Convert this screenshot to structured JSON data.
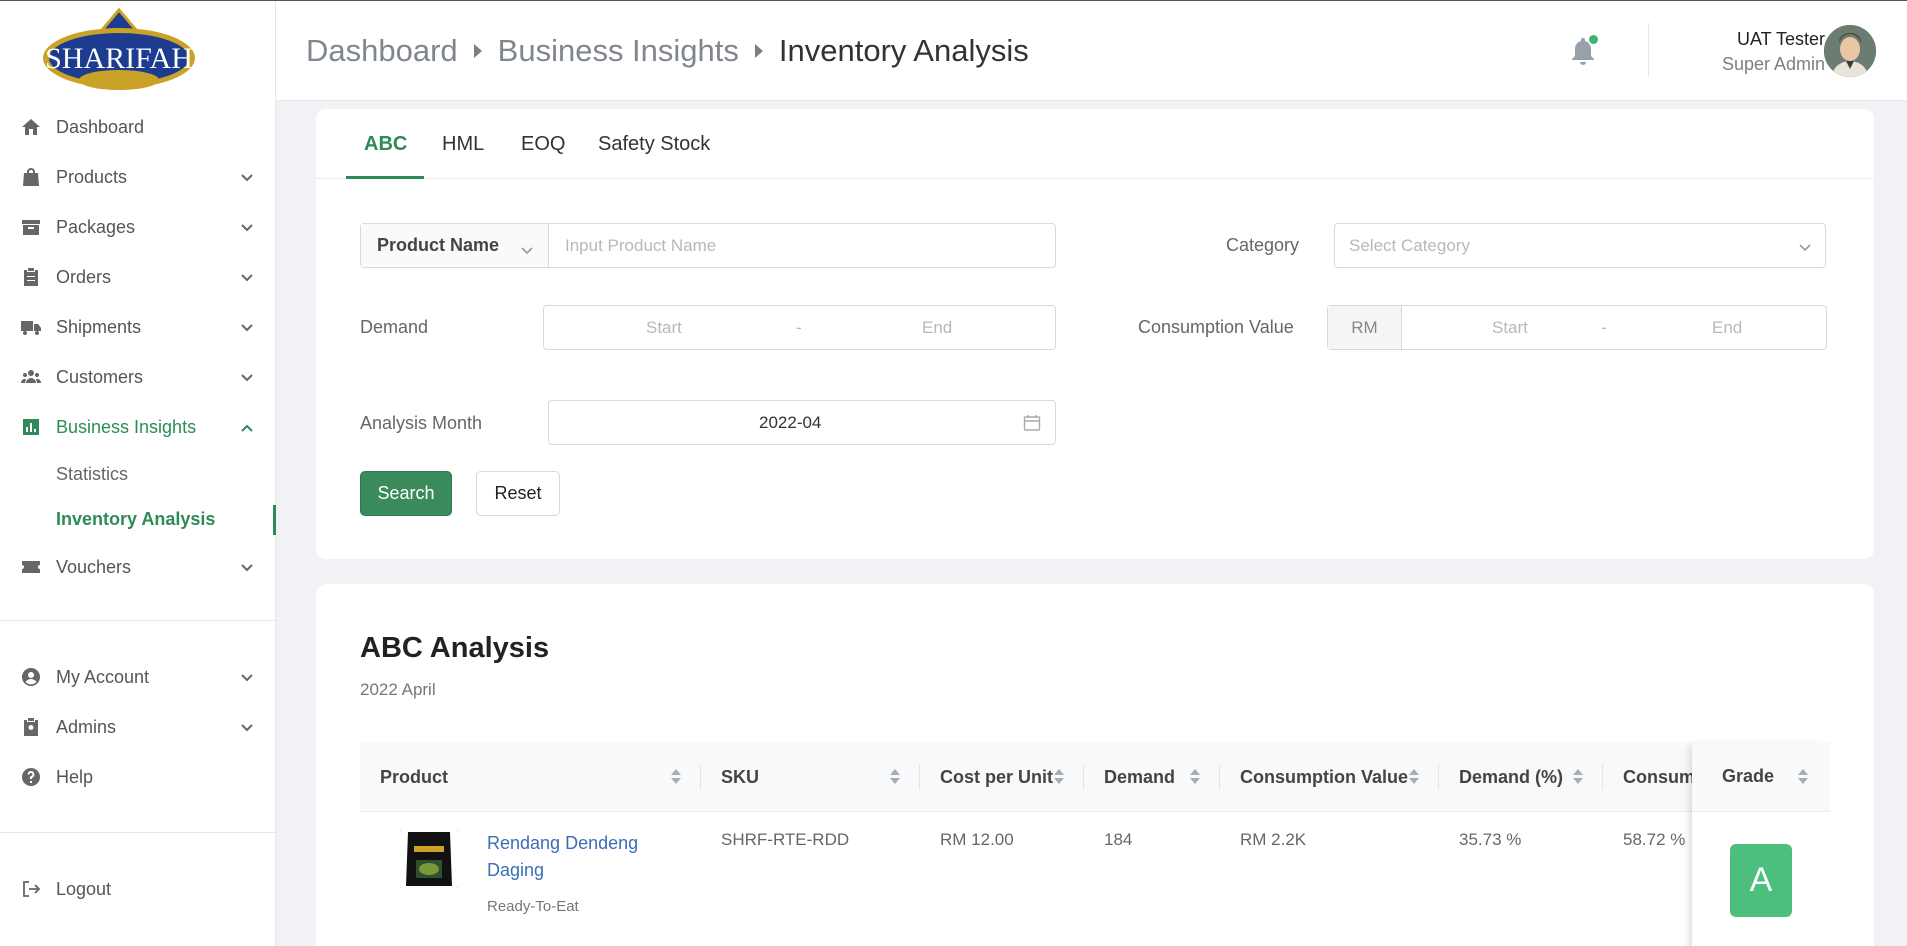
{
  "brand": {
    "logo_text": "SHARIFAH",
    "accent": "#2e8a57"
  },
  "sidebar": {
    "items": [
      {
        "label": "Dashboard",
        "icon": "home-icon"
      },
      {
        "label": "Products",
        "icon": "bag-icon"
      },
      {
        "label": "Packages",
        "icon": "archive-icon"
      },
      {
        "label": "Orders",
        "icon": "clipboard-icon"
      },
      {
        "label": "Shipments",
        "icon": "truck-icon"
      },
      {
        "label": "Customers",
        "icon": "users-icon"
      },
      {
        "label": "Business Insights",
        "icon": "chart-icon"
      }
    ],
    "sub_items": [
      {
        "label": "Statistics"
      },
      {
        "label": "Inventory Analysis"
      }
    ],
    "vouchers": "Vouchers",
    "bottom_items": [
      {
        "label": "My Account",
        "icon": "user-circle-icon"
      },
      {
        "label": "Admins",
        "icon": "badge-icon"
      },
      {
        "label": "Help",
        "icon": "help-icon"
      }
    ],
    "logout": "Logout"
  },
  "header": {
    "breadcrumb": [
      "Dashboard",
      "Business Insights",
      "Inventory Analysis"
    ],
    "user_name": "UAT Tester",
    "user_role": "Super Admin"
  },
  "tabs": [
    "ABC",
    "HML",
    "EOQ",
    "Safety Stock"
  ],
  "filters": {
    "product_select": "Product Name",
    "product_placeholder": "Input Product Name",
    "category_label": "Category",
    "category_placeholder": "Select Category",
    "demand_label": "Demand",
    "start_placeholder": "Start",
    "range_sep": "-",
    "end_placeholder": "End",
    "consumption_label": "Consumption Value",
    "currency_prefix": "RM",
    "month_label": "Analysis Month",
    "month_value": "2022-04",
    "search_button": "Search",
    "reset_button": "Reset"
  },
  "results": {
    "title": "ABC Analysis",
    "subtitle": "2022 April",
    "columns": [
      "Product",
      "SKU",
      "Cost per Unit",
      "Demand",
      "Consumption Value",
      "Demand (%)",
      "Consump",
      "Grade"
    ],
    "rows": [
      {
        "product": "Rendang Dendeng Daging",
        "category": "Ready-To-Eat",
        "sku": "SHRF-RTE-RDD",
        "cost": "RM 12.00",
        "demand": "184",
        "consumption_value": "RM 2.2K",
        "demand_pct": "35.73 %",
        "consumption_pct": "58.72 %",
        "grade": "A"
      }
    ]
  }
}
